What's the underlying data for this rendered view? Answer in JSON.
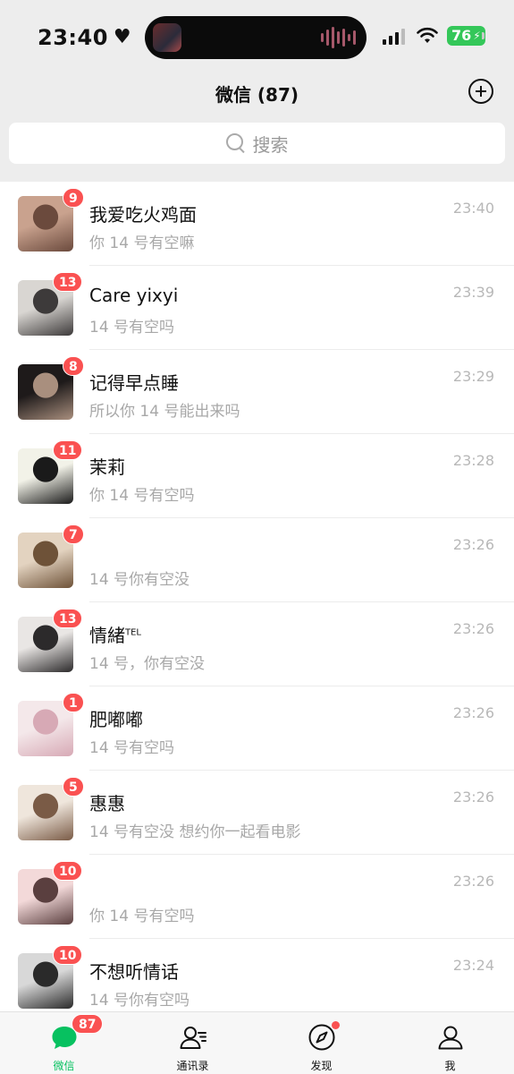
{
  "status_bar": {
    "time": "23:40",
    "battery": "76"
  },
  "header": {
    "title": "微信 (87)"
  },
  "search": {
    "placeholder": "搜索"
  },
  "chats": [
    {
      "name": "我爱吃火鸡面",
      "preview": "你 14 号有空嘛",
      "time": "23:40",
      "badge": "9",
      "avatar_colors": [
        "#c9a28e",
        "#6b4a3d"
      ]
    },
    {
      "name": "Care yixyi",
      "preview": "14 号有空吗",
      "time": "23:39",
      "badge": "13",
      "avatar_colors": [
        "#d9d6d2",
        "#3d3a3a"
      ]
    },
    {
      "name": "记得早点睡",
      "preview": "所以你 14 号能出来吗",
      "time": "23:29",
      "badge": "8",
      "avatar_colors": [
        "#1e1a1a",
        "#a98f7e"
      ]
    },
    {
      "name": "茉莉",
      "preview": "你 14 号有空吗",
      "time": "23:28",
      "badge": "11",
      "avatar_colors": [
        "#f2f2e8",
        "#1a1a1a"
      ]
    },
    {
      "name": "",
      "preview": "14 号你有空没",
      "time": "23:26",
      "badge": "7",
      "avatar_colors": [
        "#e3d3c0",
        "#6e5238"
      ]
    },
    {
      "name": "情緒",
      "name_sup": "TEL",
      "preview": "14 号，你有空没",
      "time": "23:26",
      "badge": "13",
      "avatar_colors": [
        "#e9e6e4",
        "#2c2a2b"
      ]
    },
    {
      "name": "肥嘟嘟",
      "preview": "14 号有空吗",
      "time": "23:26",
      "badge": "1",
      "avatar_colors": [
        "#f4e8ea",
        "#d7a9b5"
      ]
    },
    {
      "name": "惠惠",
      "preview": "14 号有空没 想约你一起看电影",
      "time": "23:26",
      "badge": "5",
      "avatar_colors": [
        "#efe6dc",
        "#7a5b46"
      ]
    },
    {
      "name": "",
      "preview": "你 14 号有空吗",
      "time": "23:26",
      "badge": "10",
      "avatar_colors": [
        "#f3d9d9",
        "#5a3f3f"
      ]
    },
    {
      "name": "不想听情话",
      "preview": "14 号你有空吗",
      "time": "23:24",
      "badge": "10",
      "avatar_colors": [
        "#d8d8d8",
        "#2a2a2a"
      ]
    }
  ],
  "tabs": [
    {
      "label": "微信",
      "icon": "chat-bubble-icon",
      "badge": "87",
      "active": true
    },
    {
      "label": "通讯录",
      "icon": "contacts-icon"
    },
    {
      "label": "发现",
      "icon": "compass-icon",
      "dot": true
    },
    {
      "label": "我",
      "icon": "person-icon"
    }
  ],
  "colors": {
    "accent": "#07c160",
    "badge": "#fa5151",
    "background": "#ededed"
  }
}
